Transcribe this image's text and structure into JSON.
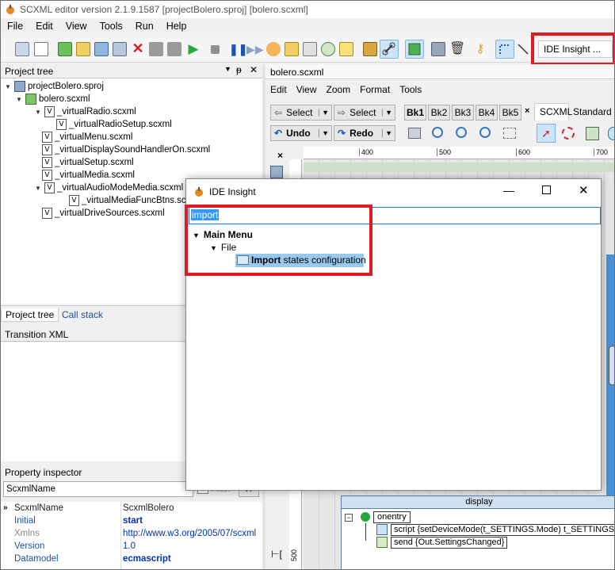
{
  "window": {
    "title": "SCXML editor version 2.1.9.1587 [projectBolero.sproj] [bolero.scxml]"
  },
  "menu": [
    "File",
    "Edit",
    "View",
    "Tools",
    "Run",
    "Help"
  ],
  "toolbar": {
    "ide_insight_label": "IDE Insight ..."
  },
  "project_tree": {
    "title": "Project tree",
    "items": [
      "projectBolero.sproj",
      "bolero.scxml",
      "_virtualRadio.scxml",
      "_virtualRadioSetup.scxml",
      "_virtualMenu.scxml",
      "_virtualDisplaySoundHandlerOn.scxml",
      "_virtualSetup.scxml",
      "_virtualMedia.scxml",
      "_virtualAudioModeMedia.scxml",
      "_virtualMediaFuncBtns.scxml",
      "_virtualDriveSources.scxml"
    ]
  },
  "bottom_tabs": [
    "Project tree",
    "Call stack"
  ],
  "transition_xml": {
    "title": "Transition XML"
  },
  "property_inspector": {
    "title": "Property inspector",
    "search_value": "ScxmlName",
    "filter_label": "Filter",
    "rows": [
      {
        "key": "ScxmlName",
        "value": "ScxmlBolero"
      },
      {
        "key": "Initial",
        "value": "start"
      },
      {
        "key": "Xmlns",
        "value": "http://www.w3.org/2005/07/scxml"
      },
      {
        "key": "Version",
        "value": "1.0"
      },
      {
        "key": "Datamodel",
        "value": "ecmascript"
      }
    ]
  },
  "editor": {
    "tab_title": "bolero.scxml",
    "menu": [
      "Edit",
      "View",
      "Zoom",
      "Format",
      "Tools"
    ],
    "select_label": "Select",
    "undo_label": "Undo",
    "redo_label": "Redo",
    "bookmarks": [
      "Bk1",
      "Bk2",
      "Bk3",
      "Bk4",
      "Bk5"
    ],
    "tabs": [
      "SCXML",
      "Standard"
    ],
    "ruler_ticks": [
      "400",
      "500",
      "600",
      "700"
    ],
    "state_name": "display",
    "onentry_label": "onentry",
    "script_label": "script {setDeviceMode(t_SETTINGS.Mode) t_SETTINGS.In",
    "send_label": "send {Out.SettingsChanged}",
    "vruler_label": "500"
  },
  "dialog": {
    "title": "IDE Insight",
    "search_value": "import",
    "group": "Main Menu",
    "subgroup": "File",
    "result_bold": "Import",
    "result_rest": " states configuration"
  },
  "colors": {
    "highlight": "#e01b24",
    "selection": "#99c9ef",
    "link": "#0033aa"
  }
}
